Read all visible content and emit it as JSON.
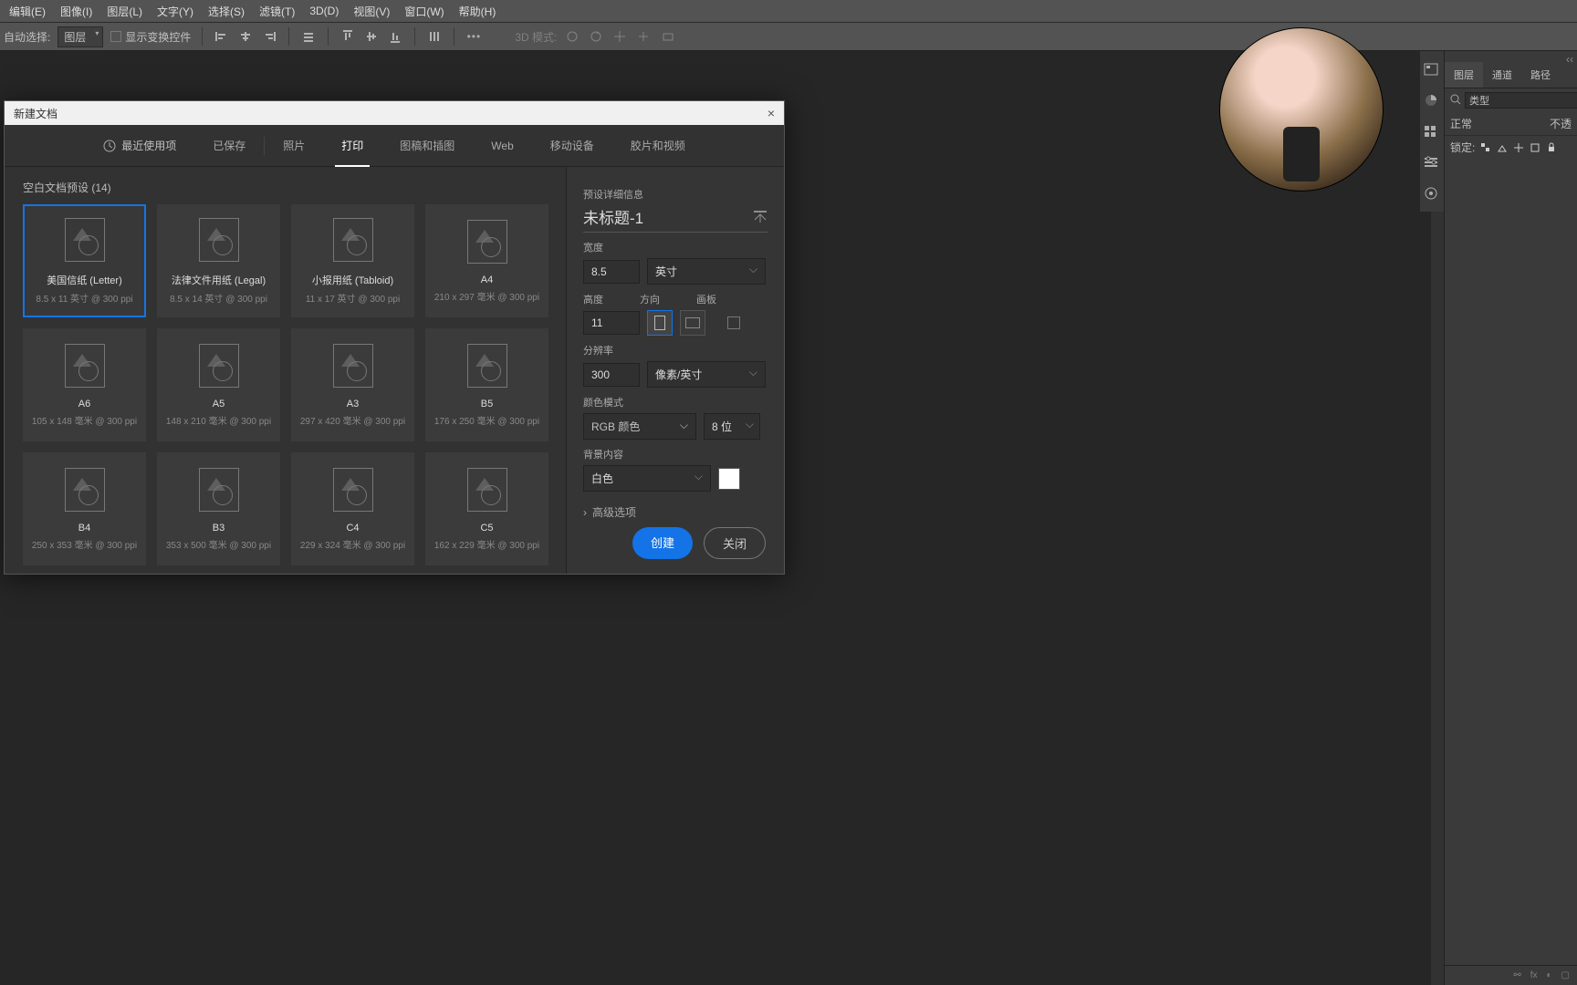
{
  "menu": [
    "编辑(E)",
    "图像(I)",
    "图层(L)",
    "文字(Y)",
    "选择(S)",
    "滤镜(T)",
    "3D(D)",
    "视图(V)",
    "窗口(W)",
    "帮助(H)"
  ],
  "optbar": {
    "autoSelect": "自动选择:",
    "layerSelect": "图层",
    "showTransform": "显示变换控件",
    "mode3d": "3D 模式:"
  },
  "panels": {
    "collapse": "‹‹",
    "tabs": [
      "图层",
      "通道",
      "路径"
    ],
    "searchPlaceholder": "类型",
    "blend": "正常",
    "opacityLabel": "不透",
    "lockLabel": "锁定:"
  },
  "dialog": {
    "title": "新建文档",
    "close": "×",
    "tabs": [
      {
        "label": "最近使用项",
        "icon": "clock-icon"
      },
      {
        "label": "已保存"
      },
      {
        "label": "照片"
      },
      {
        "label": "打印",
        "active": true
      },
      {
        "label": "图稿和插图"
      },
      {
        "label": "Web"
      },
      {
        "label": "移动设备"
      },
      {
        "label": "胶片和视频"
      }
    ],
    "presetsHeader": "空白文档预设 (14)",
    "presets": [
      {
        "t1": "美国信纸 (Letter)",
        "t2": "8.5 x 11 英寸 @ 300 ppi",
        "selected": true
      },
      {
        "t1": "法律文件用纸 (Legal)",
        "t2": "8.5 x 14 英寸 @ 300 ppi"
      },
      {
        "t1": "小报用纸 (Tabloid)",
        "t2": "11 x 17 英寸 @ 300 ppi"
      },
      {
        "t1": "A4",
        "t2": "210 x 297 毫米 @ 300 ppi"
      },
      {
        "t1": "A6",
        "t2": "105 x 148 毫米 @ 300 ppi"
      },
      {
        "t1": "A5",
        "t2": "148 x 210 毫米 @ 300 ppi"
      },
      {
        "t1": "A3",
        "t2": "297 x 420 毫米 @ 300 ppi"
      },
      {
        "t1": "B5",
        "t2": "176 x 250 毫米 @ 300 ppi"
      },
      {
        "t1": "B4",
        "t2": "250 x 353 毫米 @ 300 ppi"
      },
      {
        "t1": "B3",
        "t2": "353 x 500 毫米 @ 300 ppi"
      },
      {
        "t1": "C4",
        "t2": "229 x 324 毫米 @ 300 ppi"
      },
      {
        "t1": "C5",
        "t2": "162 x 229 毫米 @ 300 ppi"
      }
    ],
    "detail": {
      "header": "预设详细信息",
      "name": "未标题-1",
      "widthLabel": "宽度",
      "width": "8.5",
      "unit": "英寸",
      "heightLabel": "高度",
      "height": "11",
      "orientationLabel": "方向",
      "artboardsLabel": "画板",
      "resolutionLabel": "分辨率",
      "resolution": "300",
      "resUnit": "像素/英寸",
      "colorModeLabel": "颜色模式",
      "colorMode": "RGB 颜色",
      "bitDepth": "8 位",
      "bgLabel": "背景内容",
      "bg": "白色",
      "advanced": "高级选项"
    },
    "buttons": {
      "create": "创建",
      "close": "关闭"
    }
  }
}
